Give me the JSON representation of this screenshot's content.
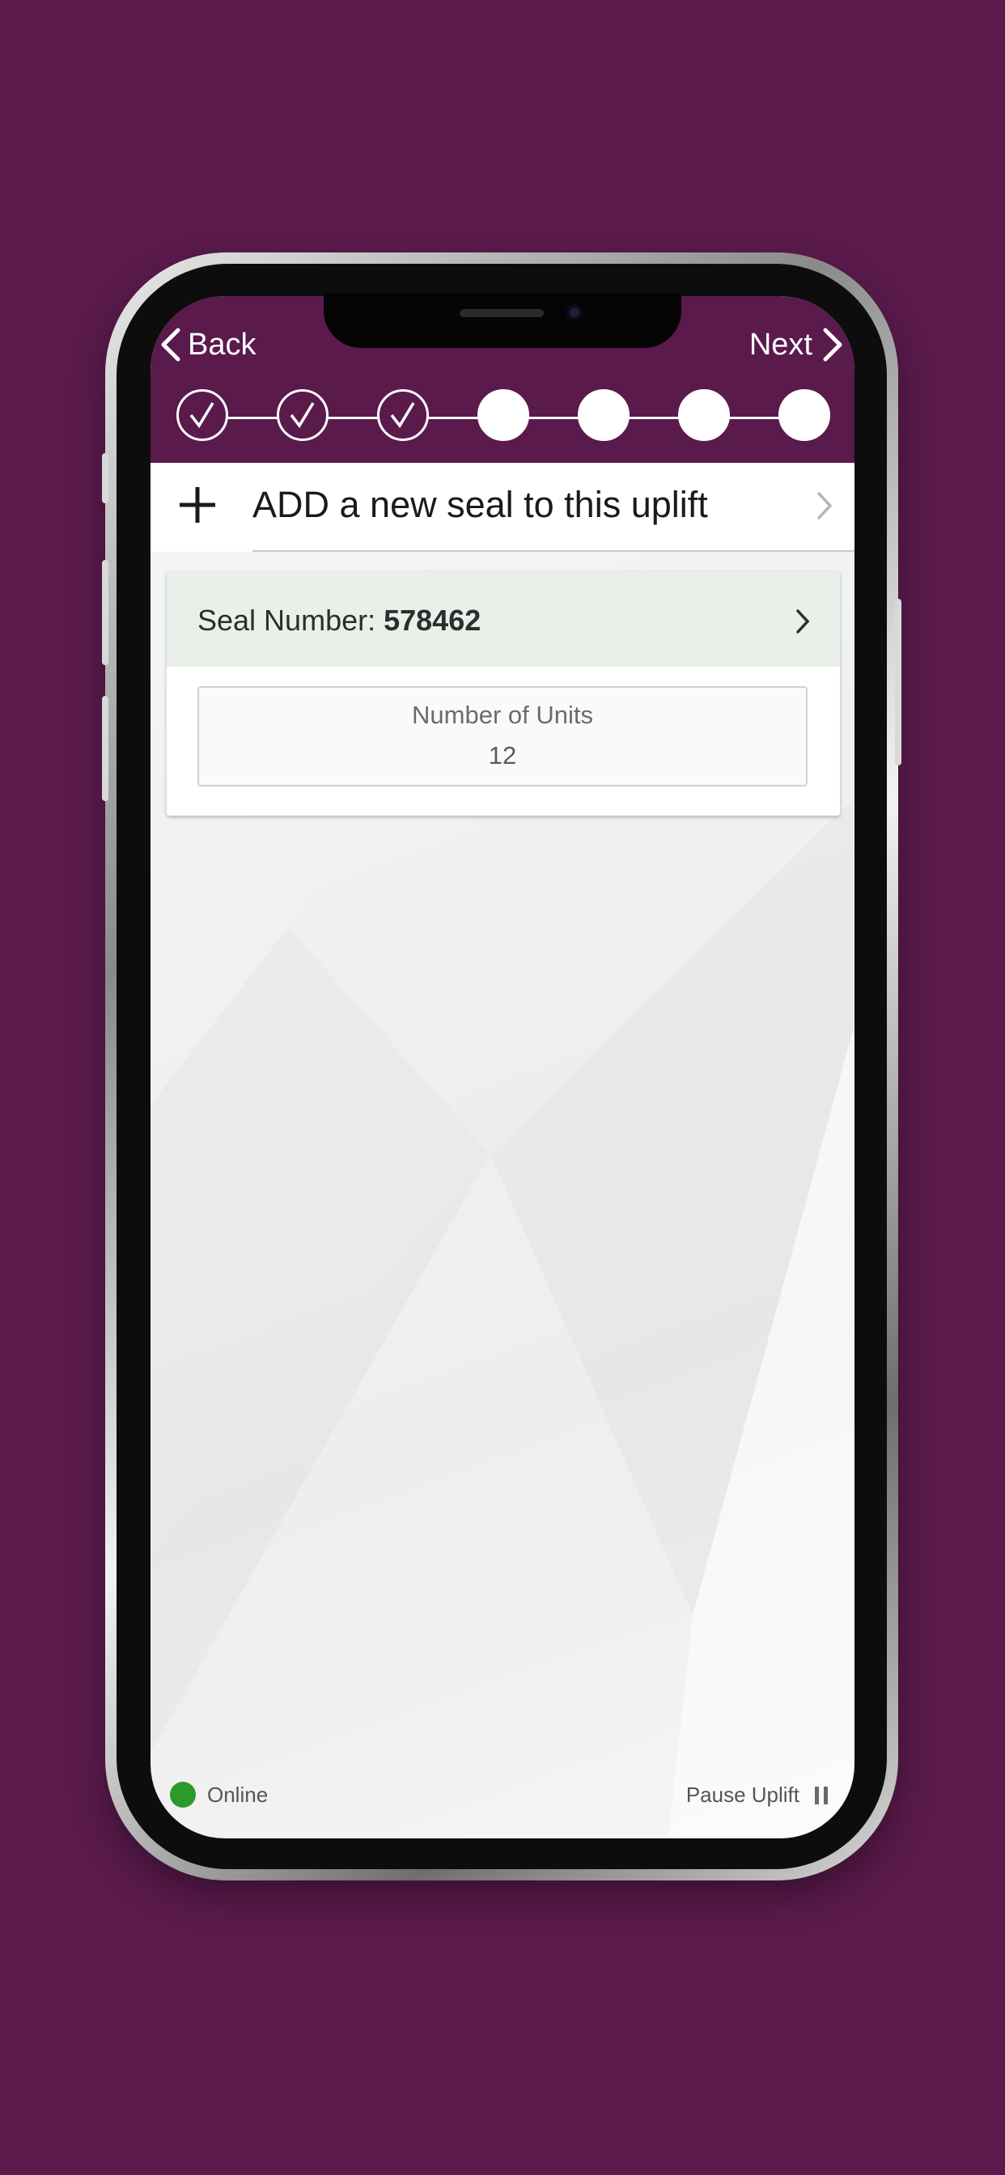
{
  "colors": {
    "background": "#5a1a4c",
    "header": "#5a1a4c",
    "card_header": "#e9efe9",
    "online_dot": "#2a9a2a"
  },
  "nav": {
    "back_label": "Back",
    "next_label": "Next"
  },
  "stepper": {
    "total_steps": 7,
    "completed_steps": 3
  },
  "add_row": {
    "label": "ADD a new seal to this uplift"
  },
  "seal_card": {
    "seal_prefix": "Seal Number: ",
    "seal_number": "578462",
    "units_label": "Number of Units",
    "units_value": "12"
  },
  "footer": {
    "status_label": "Online",
    "pause_label": "Pause Uplift"
  },
  "icons": {
    "back": "chevron-left-icon",
    "next": "chevron-right-icon",
    "add": "plus-icon",
    "status": "online-dot-icon",
    "pause": "pause-icon",
    "completed_step": "checkmark-icon"
  }
}
